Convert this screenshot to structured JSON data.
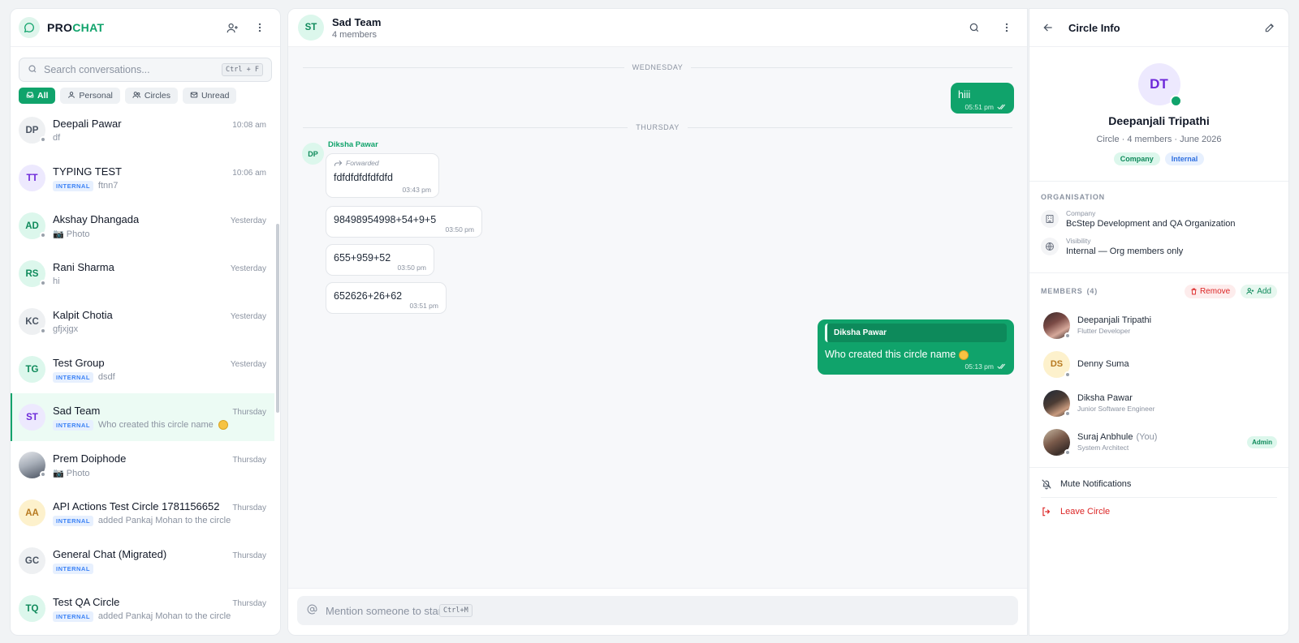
{
  "brand": {
    "part1": "PRO",
    "part2": "CHAT"
  },
  "search": {
    "placeholder": "Search conversations...",
    "shortcut": "Ctrl + F"
  },
  "filters": [
    {
      "label": "All",
      "icon": "inbox-icon",
      "active": true
    },
    {
      "label": "Personal",
      "icon": "user-icon",
      "active": false
    },
    {
      "label": "Circles",
      "icon": "users-icon",
      "active": false
    },
    {
      "label": "Unread",
      "icon": "mail-icon",
      "active": false
    }
  ],
  "conversations": [
    {
      "initials": "DP",
      "name": "Deepali Pawar",
      "time": "10:08 am",
      "tag": "",
      "preview": "df",
      "avatar_bg": "#eef0f2",
      "avatar_fg": "#4b5563",
      "status_dot": true
    },
    {
      "initials": "TT",
      "name": "TYPING TEST",
      "time": "10:06 am",
      "tag": "INTERNAL",
      "preview": "ftnn7",
      "avatar_bg": "#ede9fe",
      "avatar_fg": "#6d28d9",
      "status_dot": false
    },
    {
      "initials": "AD",
      "name": "Akshay Dhangada",
      "time": "Yesterday",
      "tag": "",
      "preview": "📷 Photo",
      "avatar_bg": "#dcf7ec",
      "avatar_fg": "#0f8a5b",
      "status_dot": true
    },
    {
      "initials": "RS",
      "name": "Rani Sharma",
      "time": "Yesterday",
      "tag": "",
      "preview": "hi",
      "avatar_bg": "#dcf7ec",
      "avatar_fg": "#0f8a5b",
      "status_dot": true
    },
    {
      "initials": "KC",
      "name": "Kalpit Chotia",
      "time": "Yesterday",
      "tag": "",
      "preview": "gfjxjgx",
      "avatar_bg": "#eef0f2",
      "avatar_fg": "#4b5563",
      "status_dot": true
    },
    {
      "initials": "TG",
      "name": "Test Group",
      "time": "Yesterday",
      "tag": "INTERNAL",
      "preview": "dsdf",
      "avatar_bg": "#dcf7ec",
      "avatar_fg": "#0f8a5b",
      "status_dot": false
    },
    {
      "initials": "ST",
      "name": "Sad Team",
      "time": "Thursday",
      "tag": "INTERNAL",
      "preview": "Who created this circle name",
      "avatar_bg": "#ede9fe",
      "avatar_fg": "#6d28d9",
      "status_dot": false,
      "active": true,
      "emoji": true
    },
    {
      "initials": "PD",
      "name": "Prem Doiphode",
      "time": "Thursday",
      "tag": "",
      "preview": "📷 Photo",
      "avatar_bg": "#d6dbe2",
      "avatar_fg": "#374151",
      "status_dot": true,
      "photo": true
    },
    {
      "initials": "AA",
      "name": "API Actions Test Circle 1781156652",
      "time": "Thursday",
      "tag": "INTERNAL",
      "preview": "added Pankaj Mohan to the circle",
      "avatar_bg": "#fdf1cc",
      "avatar_fg": "#b7791f",
      "status_dot": false
    },
    {
      "initials": "GC",
      "name": "General Chat (Migrated)",
      "time": "Thursday",
      "tag": "INTERNAL",
      "preview": "",
      "avatar_bg": "#eef0f2",
      "avatar_fg": "#4b5563",
      "status_dot": false
    },
    {
      "initials": "TQ",
      "name": "Test QA Circle",
      "time": "Thursday",
      "tag": "INTERNAL",
      "preview": "added Pankaj Mohan to the circle",
      "avatar_bg": "#dcf7ec",
      "avatar_fg": "#0f8a5b",
      "status_dot": false
    }
  ],
  "chat": {
    "initials": "ST",
    "name": "Sad Team",
    "members": "4 members",
    "day1": "WEDNESDAY",
    "day2": "THURSDAY",
    "msg_out1": {
      "text": "hiii",
      "time": "05:51 pm"
    },
    "sender": "Diksha Pawar",
    "sender_initials": "DP",
    "forwarded_label": "Forwarded",
    "msg_in1": {
      "text": "fdfdfdfdfdfdfd",
      "time": "03:43 pm"
    },
    "msg_in2": {
      "text": "98498954998+54+9+5",
      "time": "03:50 pm"
    },
    "msg_in3": {
      "text": "655+959+52",
      "time": "03:50 pm"
    },
    "msg_in4": {
      "text": "652626+26+62",
      "time": "03:51 pm"
    },
    "msg_out2": {
      "reply_to": "Diksha Pawar",
      "text": "Who created this circle name",
      "time": "05:13 pm"
    },
    "composer": {
      "placeholder": "Mention someone to start",
      "shortcut": "Ctrl+M"
    }
  },
  "info": {
    "title": "Circle Info",
    "initials": "DT",
    "name": "Deepanjali Tripathi",
    "meta": "Circle · 4 members · June 2026",
    "tags": [
      "Company",
      "Internal"
    ],
    "org_label": "ORGANISATION",
    "company_key": "Company",
    "company_value": "BcStep Development and QA Organization",
    "visibility_key": "Visibility",
    "visibility_value": "Internal — Org members only",
    "members_label": "MEMBERS",
    "members_count": "(4)",
    "remove_label": "Remove",
    "add_label": "Add",
    "members": [
      {
        "name": "Deepanjali Tripathi",
        "you": "",
        "role": "Flutter Developer",
        "initials": "",
        "photo": true,
        "admin": ""
      },
      {
        "name": "Denny Suma",
        "you": "",
        "role": "",
        "initials": "DS",
        "photo": false,
        "admin": ""
      },
      {
        "name": "Diksha Pawar",
        "you": "",
        "role": "Junior Software Engineer",
        "initials": "",
        "photo": true,
        "admin": ""
      },
      {
        "name": "Suraj Anbhule",
        "you": "(You)",
        "role": "System Architect",
        "initials": "",
        "photo": true,
        "admin": "Admin"
      }
    ],
    "mute_label": "Mute Notifications",
    "leave_label": "Leave Circle"
  }
}
